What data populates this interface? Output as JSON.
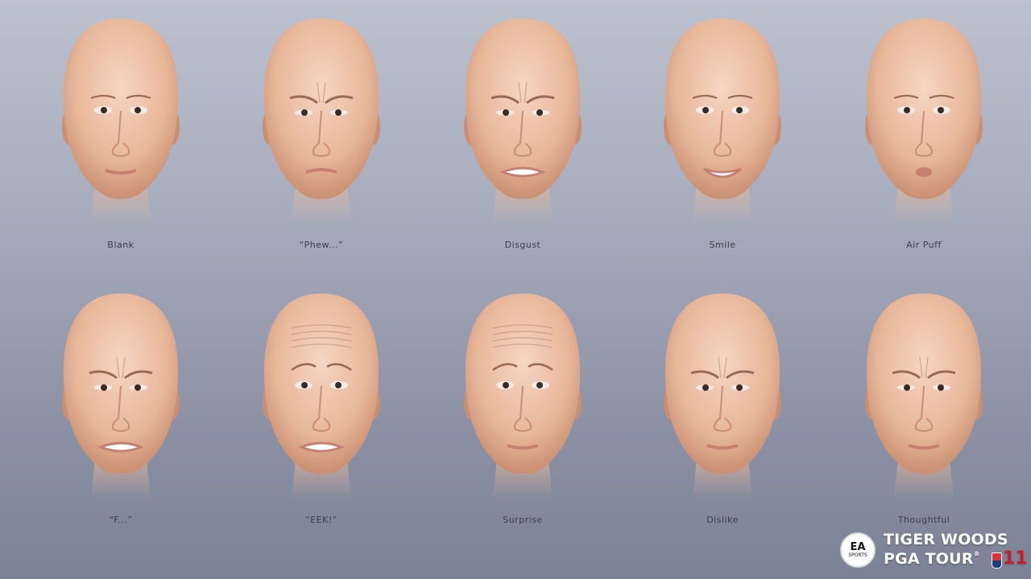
{
  "expressions": [
    {
      "caption": "Blank",
      "type": "blank"
    },
    {
      "caption": "“Phew...”",
      "type": "phew"
    },
    {
      "caption": "Disgust",
      "type": "disgust"
    },
    {
      "caption": "Smile",
      "type": "smile"
    },
    {
      "caption": "Air Puff",
      "type": "airpuff"
    },
    {
      "caption": "“F...”",
      "type": "f"
    },
    {
      "caption": "“EEK!”",
      "type": "eek"
    },
    {
      "caption": "Surprise",
      "type": "surprise"
    },
    {
      "caption": "Dislike",
      "type": "dislike"
    },
    {
      "caption": "Thoughtful",
      "type": "thoughtful"
    }
  ],
  "branding": {
    "ea_logo": "EA",
    "ea_sub": "SPORTS",
    "title_line1": "TIGER WOODS",
    "title_line2": "PGA TOUR",
    "trademark": "®",
    "edition": "11"
  },
  "colors": {
    "skin": "#e8b79a",
    "skin_shadow": "#c98f72",
    "lips": "#c77f72",
    "edition_red": "#c81d25"
  }
}
